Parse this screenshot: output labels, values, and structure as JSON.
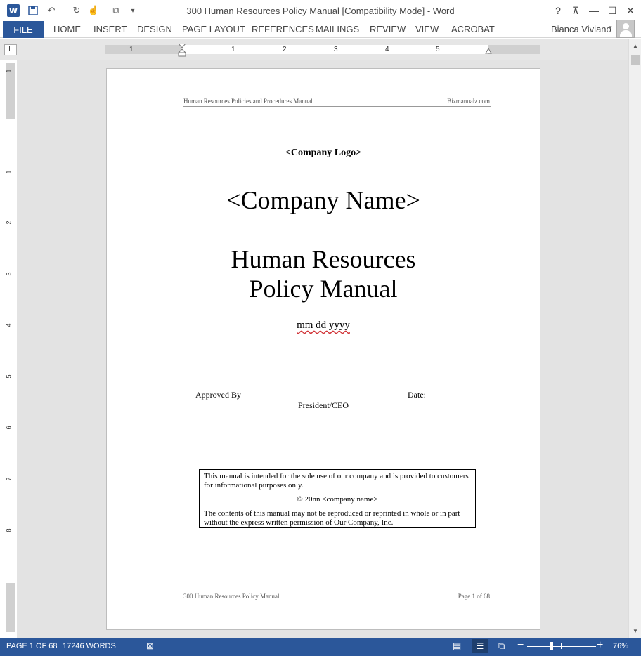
{
  "titlebar": {
    "title": "300 Human Resources Policy Manual [Compatibility Mode] - Word",
    "word_icon": "W",
    "icons": [
      "word-app-icon",
      "save-icon",
      "undo-icon",
      "redo-icon",
      "touch-mode-icon",
      "qat-more-icon",
      "qat-customize-icon"
    ],
    "controls": {
      "help": "?",
      "ribbon_options": "⊼",
      "minimize": "—",
      "maximize": "☐",
      "close": "✕"
    }
  },
  "ribbon": {
    "tabs": [
      "FILE",
      "HOME",
      "INSERT",
      "DESIGN",
      "PAGE LAYOUT",
      "REFERENCES",
      "MAILINGS",
      "REVIEW",
      "VIEW",
      "ACROBAT"
    ],
    "user_name": "Bianca Viviano"
  },
  "ruler": {
    "tab_selector": "L",
    "h_numbers": [
      "1",
      "1",
      "2",
      "3",
      "4",
      "5"
    ],
    "v_numbers": [
      "1",
      "1",
      "2",
      "3",
      "4",
      "5",
      "6",
      "7",
      "8"
    ]
  },
  "document": {
    "header_left": "Human Resources Policies and Procedures Manual",
    "header_right": "Bizmanualz.com",
    "logo_placeholder": "<Company Logo>",
    "company_name": "<Company Name>",
    "title_line1": "Human Resources",
    "title_line2": "Policy Manual",
    "date_placeholder": "mm dd yyyy",
    "approved_label": "Approved By",
    "date_label": "Date:",
    "signer_title": "President/CEO",
    "notice": {
      "p1": "This manual is intended for the sole use of our company and is provided to customers for informational purposes only.",
      "p2": "© 20nn <company name>",
      "p3": "The contents of this manual may not be reproduced or reprinted in whole or in part without the express written permission of Our Company, Inc."
    },
    "footer_left": "300 Human Resources Policy Manual",
    "footer_right": "Page 1 of 68"
  },
  "statusbar": {
    "page": "PAGE 1 OF 68",
    "words": "17246 WORDS",
    "zoom": "76%",
    "zoom_out": "−",
    "zoom_in": "+",
    "zoom_level": 0.76
  },
  "colors": {
    "accent": "#2b579a",
    "doc_background": "#e3e3e3",
    "spell_error": "#d13438"
  }
}
